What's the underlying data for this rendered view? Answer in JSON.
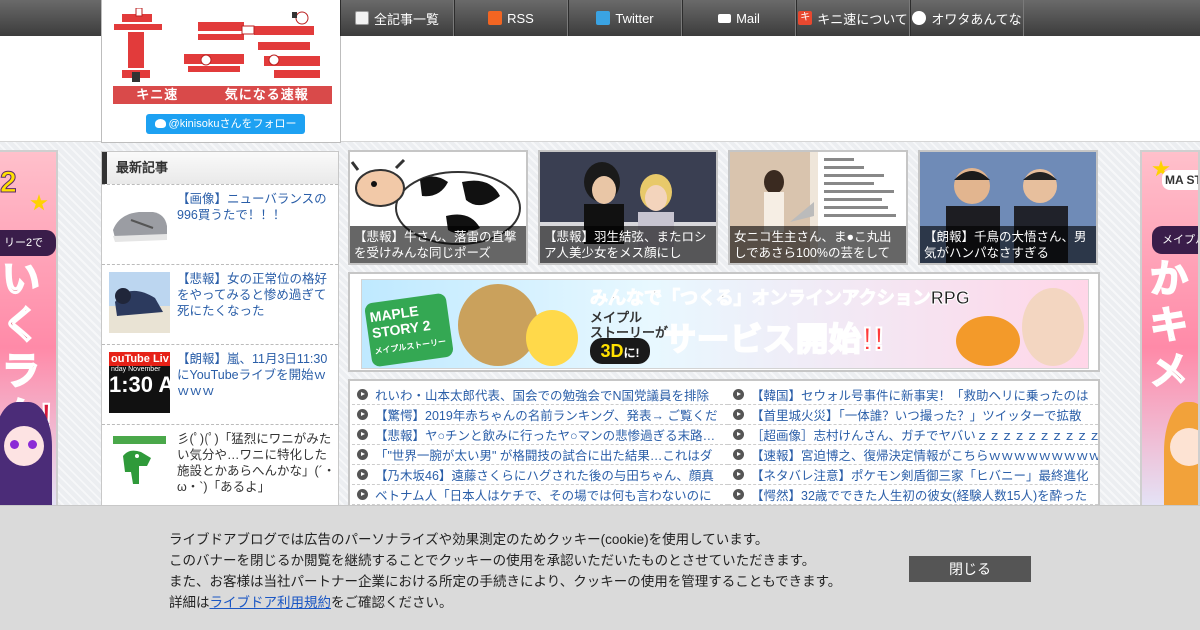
{
  "nav": {
    "items": [
      {
        "label": "全記事一覧",
        "icon": "document-icon"
      },
      {
        "label": "RSS",
        "icon": "rss-icon"
      },
      {
        "label": "Twitter",
        "icon": "twitter-icon"
      },
      {
        "label": "Mail",
        "icon": "mail-icon"
      },
      {
        "label": "キニ速について",
        "icon": "kini-icon"
      },
      {
        "label": "オワタあんてな",
        "icon": "face-icon"
      }
    ]
  },
  "header": {
    "logo_left": "キニ速",
    "logo_right": "気になる速報",
    "follow_label": "@kinisokuさんをフォロー"
  },
  "sidebar": {
    "heading": "最新記事",
    "items": [
      {
        "title": "【画像】ニューバランスの996買うたで！！！"
      },
      {
        "title": "【悲報】女の正常位の格好をやってみると惨め過ぎて死にたくなった"
      },
      {
        "title": "【朗報】嵐、11月3日11:30にYouTubeライブを開始ｗｗｗｗ",
        "thumb_text": "ouTube Liv",
        "thumb_time": "1:30 A",
        "thumb_day": "nday November"
      },
      {
        "title": "彡(ﾟ)(ﾟ)「猛烈にワニがみたい気分や…ワニに特化した施設とかあらへんかな」(´・ω・`)「あるよ」"
      }
    ]
  },
  "features": [
    {
      "caption": "【悲報】牛さん、落雷の直撃を受けみんな同じポーズ"
    },
    {
      "caption": "【悲報】羽生結弦、またロシア人美少女をメス顔にし"
    },
    {
      "caption": "女ニコ生主さん、ま●こ丸出しであさら100%の芸をして"
    },
    {
      "caption": "【朗報】千鳥の大悟さん、男気がハンパなさすぎる"
    }
  ],
  "banner": {
    "logo": "MAPLE STORY 2",
    "logo_sub": "メイプルストーリー",
    "tagline": "みんなで「つくる」オンラインアクションRPG",
    "sub1": "メイプル",
    "sub2": "ストーリーが",
    "badge": "3D",
    "badge_suffix": "に!",
    "main": "サービス開始!!"
  },
  "antenna": [
    "れいわ・山本太郎代表、国会での勉強会でN国党議員を排除",
    "【韓国】セウォル号事件に新事実！「救助ヘリに乗ったのは",
    "【驚愕】2019年赤ちゃんの名前ランキング、発表→ ご覧くだ",
    "【首里城火災】「一体誰？いつ撮った？」ツイッターで拡散",
    "【悲報】ヤ○チンと飲みに行ったヤ○マンの悲惨過ぎる末路…",
    "［超画像］志村けんさん、ガチでヤバいｚｚｚｚｚｚｚｚｚｚｚｚｚｚｚｚｚ",
    "「\"世界一腕が太い男\" が格闘技の試合に出た結果…これはダ",
    "【速報】宮迫博之、復帰決定情報がこちらｗｗｗｗｗｗｗｗｗ",
    "【乃木坂46】遠藤さくらにハグされた後の与田ちゃん、顔真",
    "【ネタバレ注意】ポケモン剣盾御三家「ヒバニー」最終進化",
    "ベトナム人「日本人はケチで、その場では何も言わないのに",
    "【愕然】32歳でできた人生初の彼女(経験人数15人)を酔った"
  ],
  "side_ad": {
    "left_top": "2",
    "left_ribbon": "リー2で",
    "left_big": "いくラク!",
    "right_top": "MA ST",
    "right_ribbon": "メイプル",
    "right_big": "かキメ"
  },
  "cookie": {
    "line1": "ライブドアブログでは広告のパーソナライズや効果測定のためクッキー(cookie)を使用しています。",
    "line2": "このバナーを閉じるか閲覧を継続することでクッキーの使用を承認いただいたものとさせていただきます。",
    "line3": "また、お客様は当社パートナー企業における所定の手続きにより、クッキーの使用を管理することもできます。",
    "line4_prefix": "詳細は",
    "line4_link": "ライブドア利用規約",
    "line4_suffix": "をご確認ください。",
    "close_label": "閉じる"
  }
}
